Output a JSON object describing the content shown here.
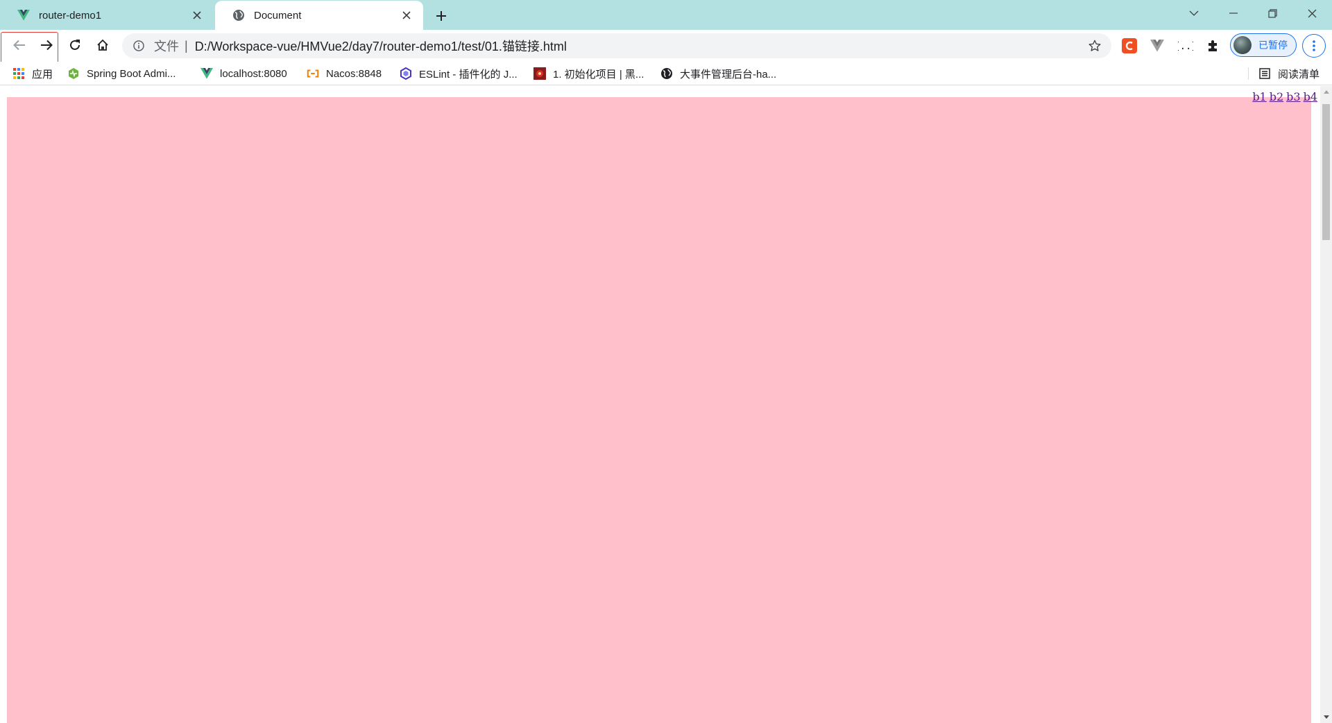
{
  "tabs": [
    {
      "title": "router-demo1",
      "icon": "vue-icon",
      "active": false
    },
    {
      "title": "Document",
      "icon": "globe-icon",
      "active": true
    }
  ],
  "window_controls": [
    "tab-search-icon",
    "minimize-icon",
    "restore-icon",
    "close-icon"
  ],
  "toolbar": {
    "scheme_label": "文件",
    "separator": "|",
    "url": "D:/Workspace-vue/HMVue2/day7/router-demo1/test/01.锚链接.html",
    "profile_label": "已暂停",
    "extensions": [
      "csdn-extension-icon",
      "vue-devtools-icon",
      "json-viewer-icon",
      "extensions-puzzle-icon"
    ]
  },
  "bookmarks": {
    "items": [
      {
        "label": "应用",
        "icon": "apps-grid-icon"
      },
      {
        "label": "Spring Boot Admi...",
        "icon": "spring-boot-admin-icon"
      },
      {
        "label": "localhost:8080",
        "icon": "vue-icon"
      },
      {
        "label": "Nacos:8848",
        "icon": "nacos-icon"
      },
      {
        "label": "ESLint - 插件化的 J...",
        "icon": "eslint-icon"
      },
      {
        "label": "1. 初始化项目 | 黑...",
        "icon": "heima-icon"
      },
      {
        "label": "大事件管理后台-ha...",
        "icon": "globe-icon"
      }
    ],
    "reading_list": "阅读清单"
  },
  "page": {
    "anchors": [
      "b1",
      "b2",
      "b3",
      "b4"
    ],
    "box_color": "#ffc0cb"
  },
  "colors": {
    "tabstrip": "#b3e0e0",
    "accent": "#1a73e8",
    "highlight": "#e53935"
  }
}
